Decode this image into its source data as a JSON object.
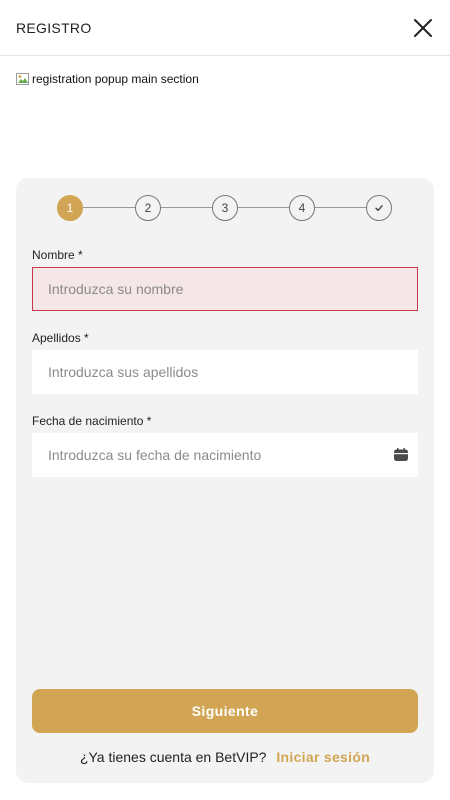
{
  "header": {
    "title": "REGISTRO"
  },
  "banner": {
    "alt_text": "registration popup main section"
  },
  "stepper": {
    "steps": [
      "1",
      "2",
      "3",
      "4"
    ],
    "active_step": 1,
    "final_icon": "check-icon"
  },
  "form": {
    "nombre": {
      "label": "Nombre *",
      "placeholder": "Introduzca su nombre",
      "value": ""
    },
    "apellidos": {
      "label": "Apellidos *",
      "placeholder": "Introduzca sus apellidos",
      "value": ""
    },
    "fecha": {
      "label": "Fecha de nacimiento *",
      "placeholder": "Introduzca su fecha de nacimiento",
      "value": "",
      "icon": "calendar-icon"
    }
  },
  "actions": {
    "next_label": "Siguiente",
    "login_prompt": "¿Ya tienes cuenta en BetVIP?",
    "login_link": "Iniciar sesión"
  },
  "colors": {
    "accent": "#d1a553",
    "error_border": "#c8374e",
    "error_background": "#f5e6e8",
    "card_background": "#f3f3f3"
  }
}
